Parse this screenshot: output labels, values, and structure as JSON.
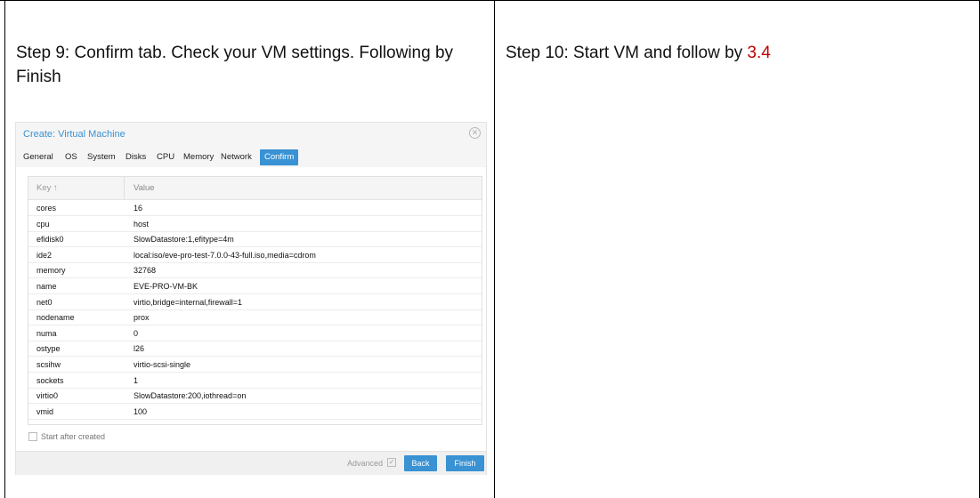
{
  "step9": {
    "text": "Step 9: Confirm tab. Check your VM settings. Following by Finish"
  },
  "step10": {
    "text": "Step 10: Start VM and follow by ",
    "ref": "3.4"
  },
  "dialog": {
    "title": "Create: Virtual Machine",
    "close_icon": "close-circle-icon",
    "tabs": [
      "General",
      "OS",
      "System",
      "Disks",
      "CPU",
      "Memory",
      "Network",
      "Confirm"
    ],
    "active_tab": "Confirm",
    "grid": {
      "key_header": "Key ↑",
      "value_header": "Value",
      "rows": [
        {
          "key": "cores",
          "value": "16"
        },
        {
          "key": "cpu",
          "value": "host"
        },
        {
          "key": "efidisk0",
          "value": "SlowDatastore:1,efitype=4m"
        },
        {
          "key": "ide2",
          "value": "local:iso/eve-pro-test-7.0.0-43-full.iso,media=cdrom"
        },
        {
          "key": "memory",
          "value": "32768"
        },
        {
          "key": "name",
          "value": "EVE-PRO-VM-BK"
        },
        {
          "key": "net0",
          "value": "virtio,bridge=internal,firewall=1"
        },
        {
          "key": "nodename",
          "value": "prox"
        },
        {
          "key": "numa",
          "value": "0"
        },
        {
          "key": "ostype",
          "value": "l26"
        },
        {
          "key": "scsihw",
          "value": "virtio-scsi-single"
        },
        {
          "key": "sockets",
          "value": "1"
        },
        {
          "key": "virtio0",
          "value": "SlowDatastore:200,iothread=on"
        },
        {
          "key": "vmid",
          "value": "100"
        }
      ]
    },
    "start_after_created": "Start after created",
    "advanced_label": "Advanced",
    "back_label": "Back",
    "finish_label": "Finish"
  }
}
